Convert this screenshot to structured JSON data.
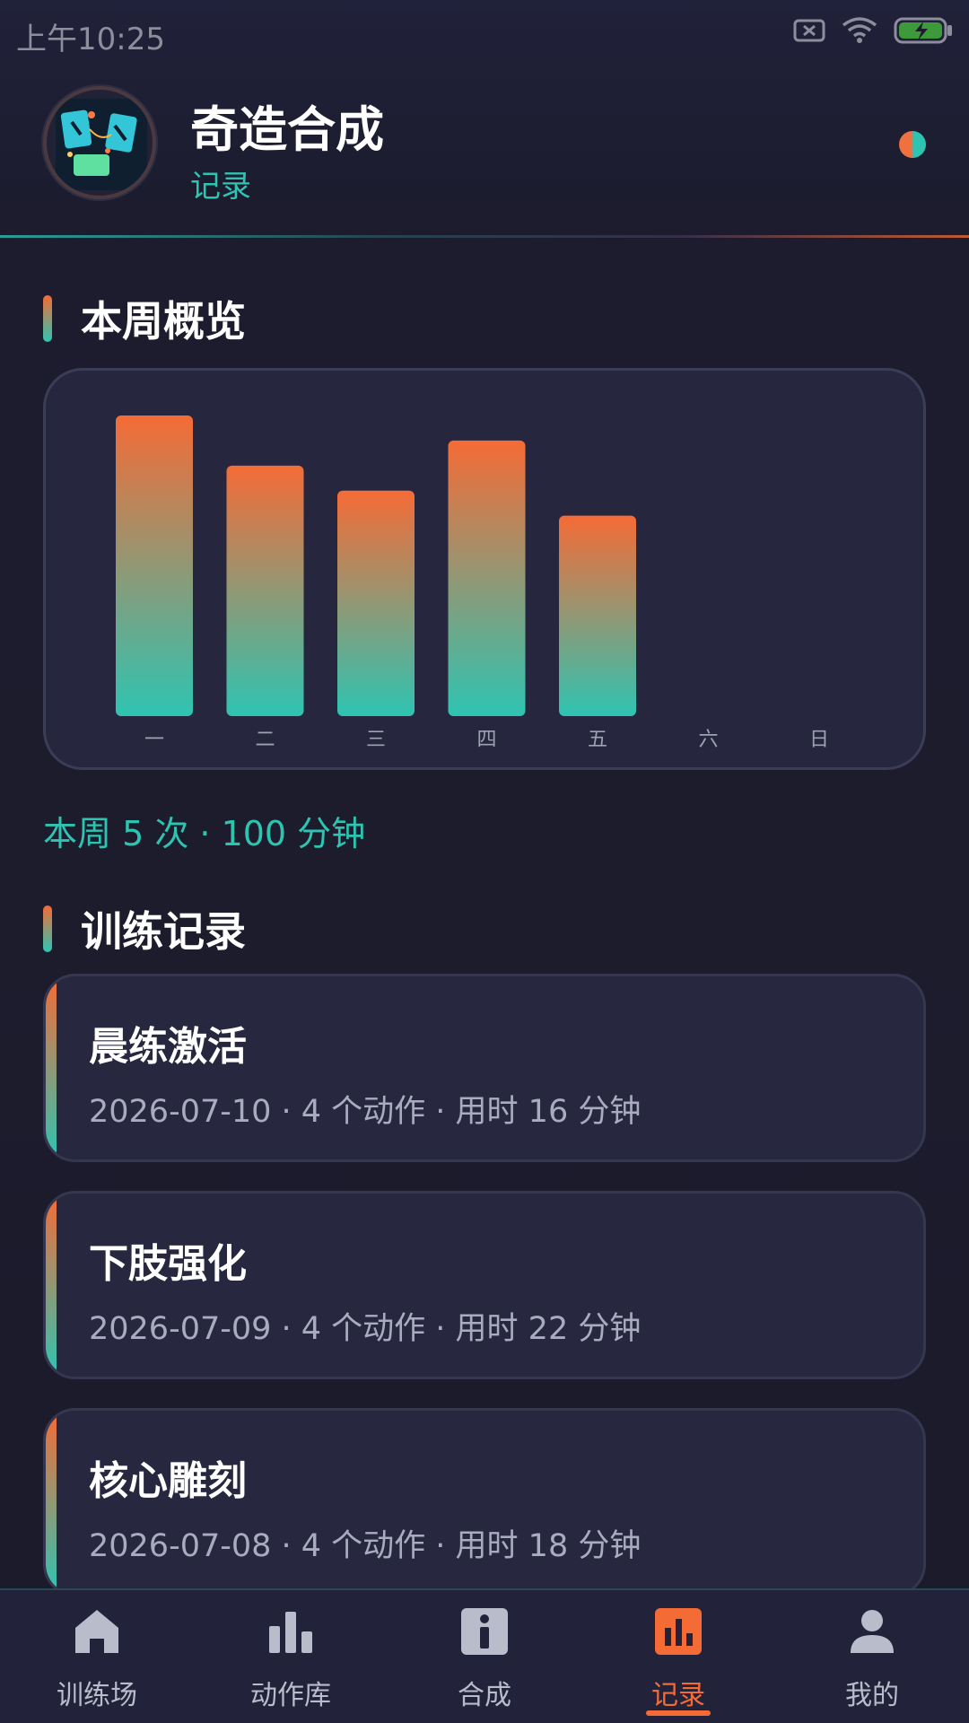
{
  "status_bar": {
    "time": "上午10:25",
    "icons": [
      "sim-off-icon",
      "wifi-icon",
      "battery-charging-icon"
    ]
  },
  "header": {
    "app_name": "奇造合成",
    "subtitle": "记录",
    "avatar_icon": "app-logo-icon"
  },
  "overview": {
    "title": "本周概览",
    "summary": "本周 5 次 · 100 分钟"
  },
  "chart_data": {
    "type": "bar",
    "categories": [
      "一",
      "二",
      "三",
      "四",
      "五",
      "六",
      "日"
    ],
    "values": [
      24,
      20,
      18,
      22,
      16,
      0,
      0
    ],
    "title": "",
    "xlabel": "",
    "ylabel": "",
    "ylim": [
      0,
      24
    ],
    "colors": {
      "top": "#f56b36",
      "bottom": "#2ec4b2"
    }
  },
  "records": {
    "title": "训练记录",
    "items": [
      {
        "name": "晨练激活",
        "meta": "2026-07-10 · 4 个动作 · 用时 16 分钟"
      },
      {
        "name": "下肢强化",
        "meta": "2026-07-09 · 4 个动作 · 用时 22 分钟"
      },
      {
        "name": "核心雕刻",
        "meta": "2026-07-08 · 4 个动作 · 用时 18 分钟"
      }
    ]
  },
  "nav": {
    "items": [
      {
        "label": "训练场",
        "icon": "home-icon"
      },
      {
        "label": "动作库",
        "icon": "bar-chart-icon"
      },
      {
        "label": "合成",
        "icon": "info-icon"
      },
      {
        "label": "记录",
        "icon": "stats-icon"
      },
      {
        "label": "我的",
        "icon": "person-icon"
      }
    ],
    "active_index": 3
  },
  "colors": {
    "accent_orange": "#f56b36",
    "accent_teal": "#2ec4b2",
    "background": "#1c1c2e"
  }
}
